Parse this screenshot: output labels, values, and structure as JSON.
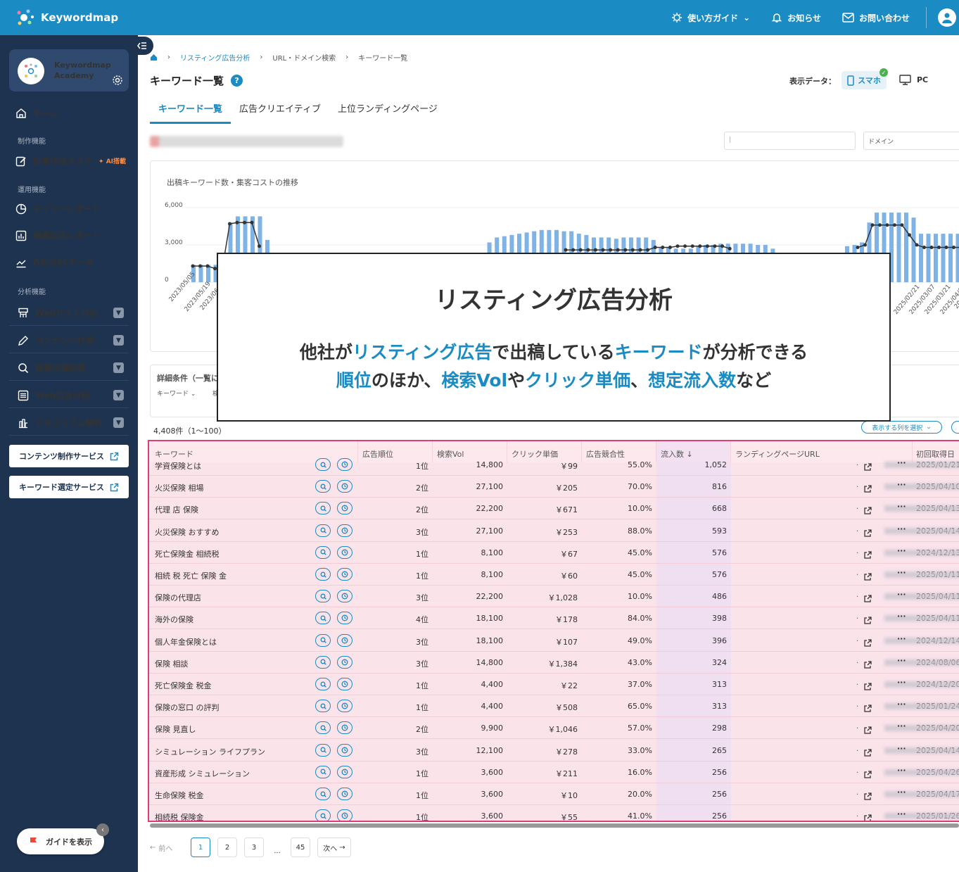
{
  "topbar": {
    "logo": "Keywordmap",
    "nav": [
      {
        "label": "使い方ガイド"
      },
      {
        "label": "お知らせ"
      },
      {
        "label": "お問い合わせ"
      }
    ]
  },
  "sidebar": {
    "account_line1": "Keywordmap",
    "account_line2": "Academy",
    "home": "ホーム",
    "sec_create": "制作機能",
    "article_task": "記事作成タスク",
    "ai_badge": "AI搭載",
    "sec_ops": "運用機能",
    "daily_report": "デイリーレポート",
    "rank_report": "検索順位レポート",
    "ga_gsc": "GA/GSCデータ",
    "sec_analysis": "分析機能",
    "expandables": [
      "Webサイト分析",
      "コンテンツ作成",
      "検索市場調査",
      "Web広告分析",
      "アルゴリズム解析"
    ],
    "service1": "コンテンツ制作サービス",
    "service2": "キーワード選定サービス",
    "guide_button": "ガイドを表示"
  },
  "breadcrumb": [
    "リスティング広告分析",
    "URL・ドメイン検索",
    "キーワード一覧"
  ],
  "page_title": "キーワード一覧",
  "display_data": {
    "label": "表示データ：",
    "smartphone": "スマホ",
    "pc": "PC"
  },
  "tabs": [
    "キーワード一覧",
    "広告クリエイティブ",
    "上位ランディングページ"
  ],
  "domain_select": "ドメイン",
  "chart_data": {
    "type": "bar",
    "title": "出稿キーワード数・集客コストの推移",
    "y_ticks": [
      "6,000",
      "3,000",
      "0"
    ],
    "x_ticks": [
      "2023/05/05",
      "2023/05/19",
      "2023/06",
      "2025/02/21",
      "2025/03/07",
      "2025/03/21",
      "2025/04/04",
      "2025/"
    ],
    "bars_left": [
      1400,
      1400,
      1400,
      1400,
      1400,
      4800,
      5300,
      5300,
      5300,
      5300,
      3400
    ],
    "line_left": [
      1300,
      1300,
      1300,
      1100,
      1100,
      4700,
      4800,
      4800,
      4800,
      2900
    ],
    "bars_mid": [
      2000,
      3200,
      3600,
      3700,
      3800,
      3900,
      4000,
      4100,
      4200,
      4200,
      4200,
      4100,
      4100,
      3900,
      3800,
      3600,
      3600,
      3600,
      3500,
      3600,
      3600,
      3600,
      3600,
      3400,
      2800,
      2800,
      2700,
      2700,
      2700,
      2900,
      3000,
      3000,
      3100,
      3100,
      3100,
      3100,
      3100,
      3000,
      3000,
      2700
    ],
    "line_mid": [
      2600,
      2600,
      2600,
      2600,
      2600,
      2600,
      2600,
      2600,
      2600,
      2600,
      2600,
      2600,
      2800,
      2800,
      2800,
      2900,
      2900,
      2900,
      2900,
      2900,
      2900,
      2900,
      2700
    ],
    "bars_right": [
      2900,
      3000,
      3200,
      4800,
      5600,
      5600,
      5600,
      5600,
      5600,
      5200,
      3900,
      3900,
      3900,
      3900,
      3900,
      3900,
      3900,
      3900
    ],
    "line_right": [
      2800,
      3000,
      4600,
      4600,
      4600,
      4600,
      4600,
      3800,
      3000,
      2800,
      2800,
      2800,
      2800,
      2800,
      2800,
      2800
    ]
  },
  "detail": {
    "title": "詳細条件（一覧に",
    "keyword_dd": "キーワード",
    "trailing": "検"
  },
  "overlay": {
    "title": "リスティング広告分析",
    "line1": [
      {
        "t": "他社が",
        "h": false
      },
      {
        "t": "リスティング広告",
        "h": true
      },
      {
        "t": "で出稿している",
        "h": false
      },
      {
        "t": "キーワード",
        "h": true
      },
      {
        "t": "が分析できる",
        "h": false
      }
    ],
    "line2": [
      {
        "t": "順位",
        "h": true
      },
      {
        "t": "のほか、",
        "h": false
      },
      {
        "t": "検索Vol",
        "h": true
      },
      {
        "t": "や",
        "h": false
      },
      {
        "t": "クリック単価",
        "h": true
      },
      {
        "t": "、",
        "h": false
      },
      {
        "t": "想定流入数",
        "h": true
      },
      {
        "t": "など",
        "h": false
      }
    ]
  },
  "results_count": "4,408件（1〜100）",
  "column_select": "表示する列を選択",
  "table": {
    "headers": [
      "キーワード",
      "広告順位",
      "検索Vol",
      "クリック単価",
      "広告競合性",
      "流入数",
      "ランディングページURL",
      "初回取得日"
    ],
    "rows": [
      [
        "学資保険とは",
        "1位",
        "14,800",
        "￥99",
        "55.0%",
        "1,052",
        "2025/01/21"
      ],
      [
        "火災保険 相場",
        "2位",
        "27,100",
        "￥205",
        "70.0%",
        "816",
        "2025/04/10"
      ],
      [
        "代理 店 保険",
        "2位",
        "22,200",
        "￥671",
        "10.0%",
        "668",
        "2025/04/13"
      ],
      [
        "火災保険 おすすめ",
        "3位",
        "27,100",
        "￥253",
        "88.0%",
        "593",
        "2025/04/14"
      ],
      [
        "死亡保険金 相続税",
        "1位",
        "8,100",
        "￥67",
        "45.0%",
        "576",
        "2024/12/13"
      ],
      [
        "相続 税 死亡 保険 金",
        "1位",
        "8,100",
        "￥60",
        "45.0%",
        "576",
        "2025/01/11"
      ],
      [
        "保険の代理店",
        "3位",
        "22,200",
        "￥1,028",
        "10.0%",
        "486",
        "2025/04/11"
      ],
      [
        "海外の保険",
        "4位",
        "18,100",
        "￥178",
        "84.0%",
        "398",
        "2025/04/11"
      ],
      [
        "個人年金保険とは",
        "3位",
        "18,100",
        "￥107",
        "49.0%",
        "396",
        "2024/12/14"
      ],
      [
        "保険 相談",
        "3位",
        "14,800",
        "￥1,384",
        "43.0%",
        "324",
        "2024/08/06"
      ],
      [
        "死亡保険金 税金",
        "1位",
        "4,400",
        "￥22",
        "37.0%",
        "313",
        "2024/12/20"
      ],
      [
        "保険の窓口 の評判",
        "1位",
        "4,400",
        "￥508",
        "65.0%",
        "313",
        "2025/01/24"
      ],
      [
        "保険 見直し",
        "2位",
        "9,900",
        "￥1,046",
        "57.0%",
        "298",
        "2025/04/20"
      ],
      [
        "シミュレーション ライフプラン",
        "3位",
        "12,100",
        "￥278",
        "33.0%",
        "265",
        "2025/04/14"
      ],
      [
        "資産形成 シミュレーション",
        "1位",
        "3,600",
        "￥211",
        "16.0%",
        "256",
        "2025/04/26"
      ],
      [
        "生命保険 税金",
        "1位",
        "3,600",
        "￥10",
        "20.0%",
        "256",
        "2025/04/17"
      ],
      [
        "相続税 保険金",
        "1位",
        "3,600",
        "￥55",
        "41.0%",
        "256",
        "2025/01/26"
      ]
    ]
  },
  "pager": {
    "prev": "前へ",
    "pages": [
      "1",
      "2",
      "3"
    ],
    "ellipsis": "...",
    "last": "45",
    "next": "次へ"
  },
  "colors": {
    "brand": "#1b8bc4",
    "sidebar": "#1e3350",
    "highlight_border": "#e03c78",
    "bar": "#7fb3e6",
    "line": "#333333"
  }
}
